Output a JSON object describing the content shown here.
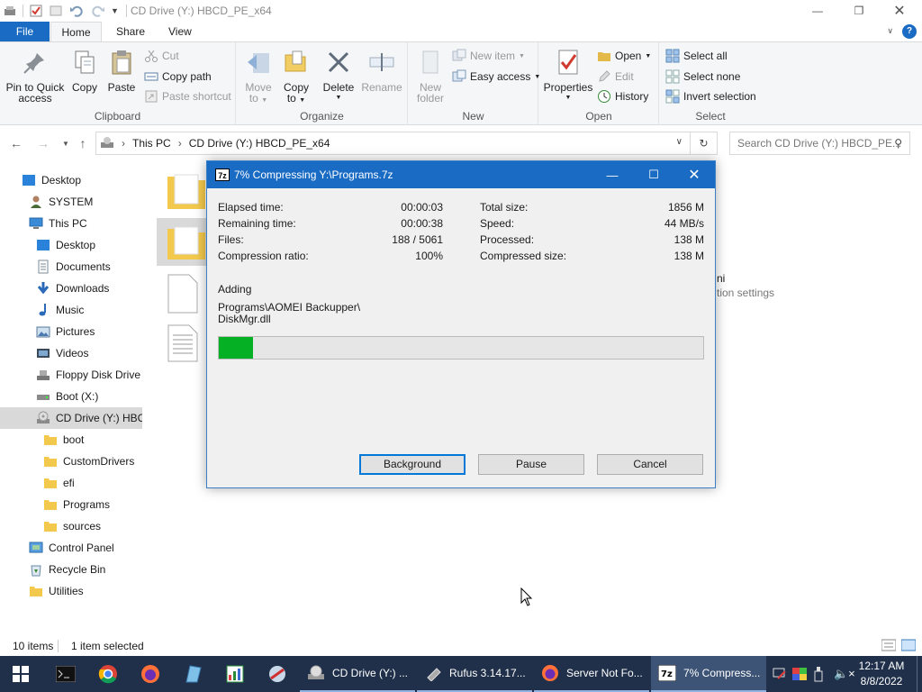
{
  "window": {
    "title": "CD Drive (Y:) HBCD_PE_x64"
  },
  "ribbon_tabs": [
    "File",
    "Home",
    "Share",
    "View"
  ],
  "ribbon": {
    "clipboard": {
      "label": "Clipboard",
      "pin_label_1": "Pin to Quick",
      "pin_label_2": "access",
      "copy_label": "Copy",
      "paste_label": "Paste",
      "cut_label": "Cut",
      "copy_path_label": "Copy path",
      "paste_shortcut_label": "Paste shortcut"
    },
    "organize": {
      "label": "Organize",
      "move_to_1": "Move",
      "move_to_2": "to",
      "copy_to_1": "Copy",
      "copy_to_2": "to",
      "delete_label": "Delete",
      "rename_label": "Rename"
    },
    "new": {
      "label": "New",
      "new_folder_1": "New",
      "new_folder_2": "folder",
      "new_item_label": "New item",
      "easy_access_label": "Easy access"
    },
    "open": {
      "label": "Open",
      "properties_label": "Properties",
      "open_label": "Open",
      "edit_label": "Edit",
      "history_label": "History"
    },
    "select": {
      "label": "Select",
      "select_all_label": "Select all",
      "select_none_label": "Select none",
      "invert_label": "Invert selection"
    }
  },
  "address": {
    "crumb_this_pc": "This PC",
    "crumb_drive": "CD Drive (Y:) HBCD_PE_x64",
    "search_placeholder": "Search CD Drive (Y:) HBCD_PE..."
  },
  "nav_pane": {
    "items": [
      {
        "label": "Desktop"
      },
      {
        "label": "SYSTEM"
      },
      {
        "label": "This PC"
      },
      {
        "label": "Desktop"
      },
      {
        "label": "Documents"
      },
      {
        "label": "Downloads"
      },
      {
        "label": "Music"
      },
      {
        "label": "Pictures"
      },
      {
        "label": "Videos"
      },
      {
        "label": "Floppy Disk Drive"
      },
      {
        "label": "Boot (X:)"
      },
      {
        "label": "CD Drive (Y:) HBC"
      },
      {
        "label": "boot"
      },
      {
        "label": "CustomDrivers"
      },
      {
        "label": "efi"
      },
      {
        "label": "Programs"
      },
      {
        "label": "sources"
      },
      {
        "label": "Control Panel"
      },
      {
        "label": "Recycle Bin"
      },
      {
        "label": "Utilities"
      }
    ]
  },
  "content": {
    "partial_text_1": "ni",
    "partial_text_2": "tion settings"
  },
  "status": {
    "items_count": "10 items",
    "selected": "1 item selected"
  },
  "dialog": {
    "title": "7% Compressing Y:\\Programs.7z",
    "logo": "7z",
    "elapsed_label": "Elapsed time:",
    "elapsed_value": "00:00:03",
    "remaining_label": "Remaining time:",
    "remaining_value": "00:00:38",
    "files_label": "Files:",
    "files_value": "188 / 5061",
    "ratio_label": "Compression ratio:",
    "ratio_value": "100%",
    "total_label": "Total size:",
    "total_value": "1856 M",
    "speed_label": "Speed:",
    "speed_value": "44 MB/s",
    "processed_label": "Processed:",
    "processed_value": "138 M",
    "compressed_label": "Compressed size:",
    "compressed_value": "138 M",
    "adding_label": "Adding",
    "current_file_1": "Programs\\AOMEI Backupper\\",
    "current_file_2": "DiskMgr.dll",
    "progress_percent": 7,
    "background_button": "Background",
    "pause_button": "Pause",
    "cancel_button": "Cancel"
  },
  "taskbar": {
    "tasks": [
      {
        "label": "CD Drive (Y:) ..."
      },
      {
        "label": "Rufus 3.14.17..."
      },
      {
        "label": "Server Not Fo..."
      },
      {
        "label": "7% Compress..."
      }
    ],
    "time": "12:17 AM",
    "date": "8/8/2022"
  },
  "colors": {
    "accent": "#1a6bc3",
    "progress_fill": "#06b025",
    "taskbar": "#20304a"
  }
}
